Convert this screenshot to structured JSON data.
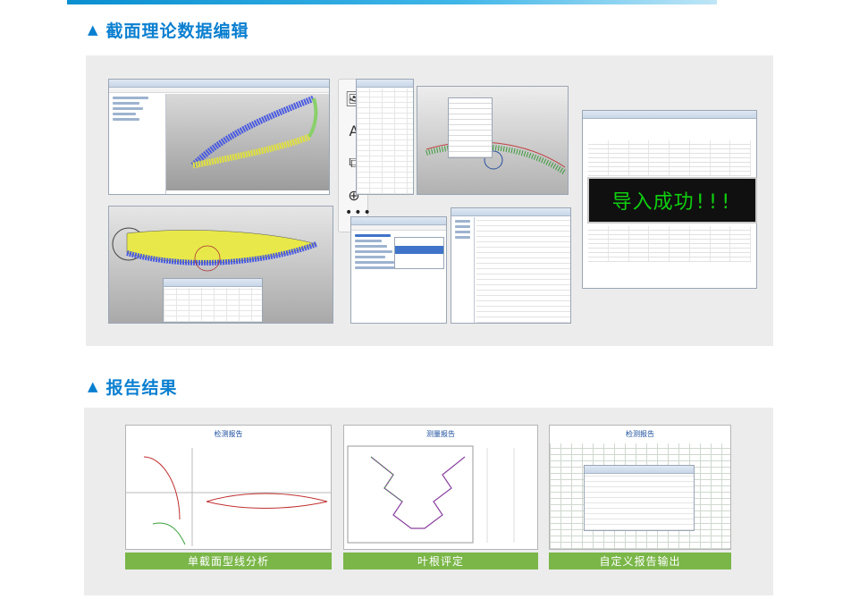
{
  "sections": [
    {
      "title": "截面理论数据编辑"
    },
    {
      "title": "报告结果"
    }
  ],
  "overlay": {
    "success_text": "导入成功!!!"
  },
  "reports": [
    {
      "header": "检测报告",
      "caption": "单截面型线分析"
    },
    {
      "header": "测量报告",
      "caption": "叶根评定"
    },
    {
      "header": "检测报告",
      "caption": "自定义报告输出"
    }
  ],
  "colors": {
    "title": "#0a7fd0",
    "caption_bg": "#7ab648",
    "success_text": "#0fd00f"
  }
}
